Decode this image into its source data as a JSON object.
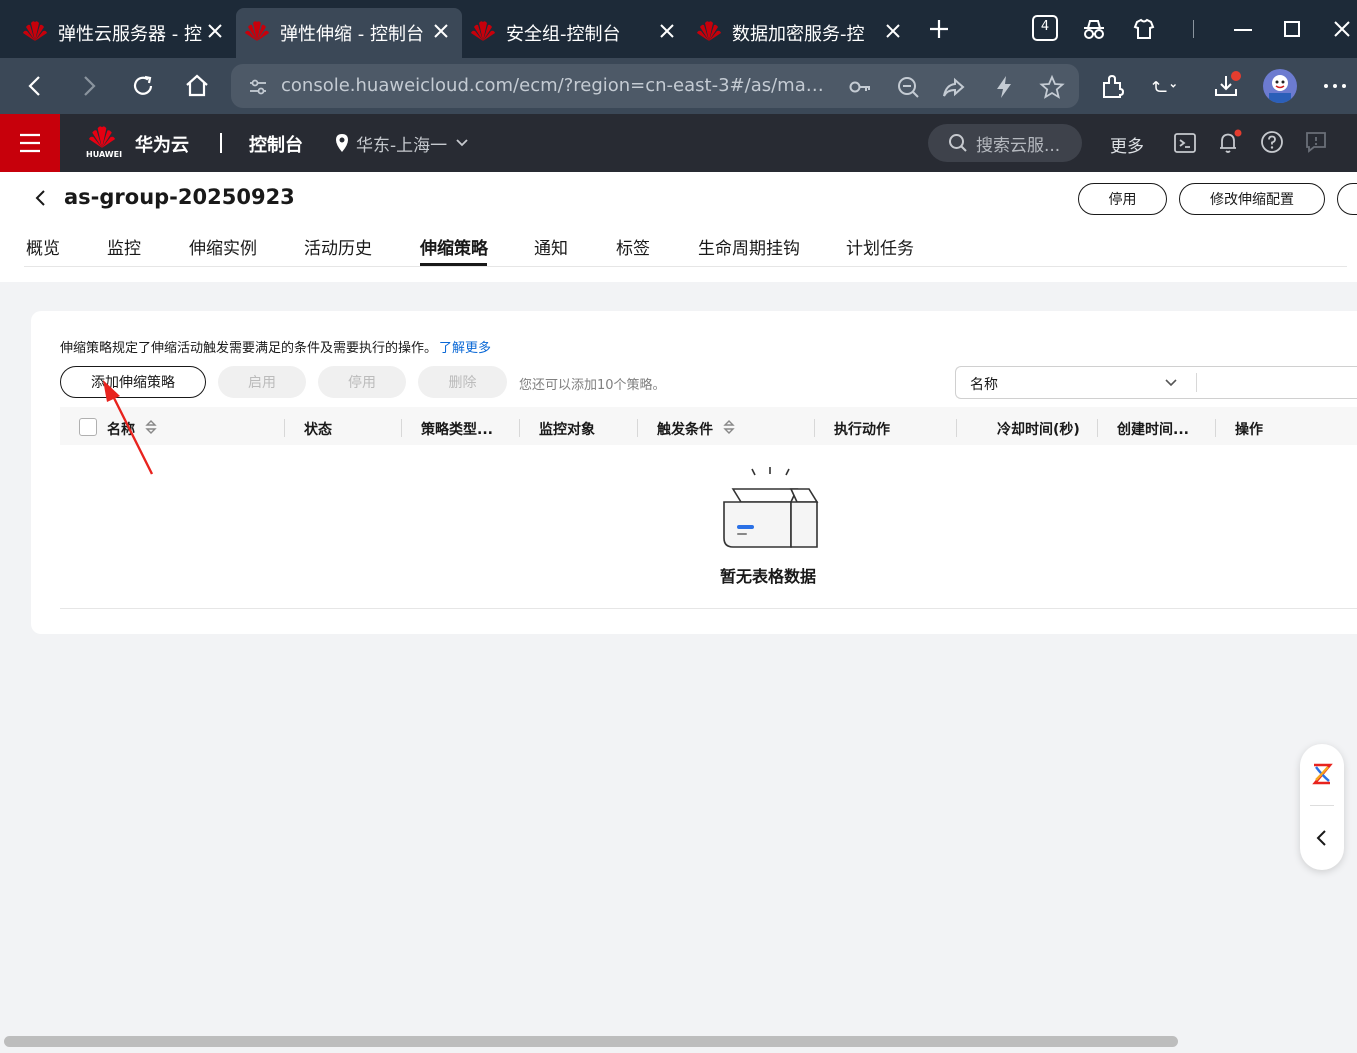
{
  "browser": {
    "tabs": [
      {
        "title": "弹性云服务器 - 控",
        "active": false
      },
      {
        "title": "弹性伸缩 - 控制台",
        "active": true
      },
      {
        "title": "安全组-控制台",
        "active": false
      },
      {
        "title": "数据加密服务-控",
        "active": false
      }
    ],
    "tab_count_badge": "4",
    "url": "console.huaweicloud.com/ecm/?region=cn-east-3#/as/mana..."
  },
  "console": {
    "brand": "华为云",
    "brand_sub": "HUAWEI",
    "section": "控制台",
    "region": "华东-上海一",
    "search_placeholder": "搜索云服...",
    "more": "更多"
  },
  "page": {
    "title": "as-group-20250923",
    "actions": {
      "disable": "停用",
      "modify": "修改伸缩配置"
    },
    "tabs": [
      "概览",
      "监控",
      "伸缩实例",
      "活动历史",
      "伸缩策略",
      "通知",
      "标签",
      "生命周期挂钩",
      "计划任务"
    ],
    "active_tab": "伸缩策略"
  },
  "policy_panel": {
    "description": "伸缩策略规定了伸缩活动触发需要满足的条件及需要执行的操作。",
    "learn_more": "了解更多",
    "buttons": {
      "add": "添加伸缩策略",
      "enable": "启用",
      "disable": "停用",
      "delete": "删除"
    },
    "quota_hint": "您还可以添加10个策略。",
    "filter_select": "名称",
    "columns": [
      "名称",
      "状态",
      "策略类型...",
      "监控对象",
      "触发条件",
      "执行动作",
      "冷却时间(秒)",
      "创建时间...",
      "操作"
    ],
    "empty_text": "暂无表格数据"
  },
  "colors": {
    "huawei_red": "#c7000b",
    "link_blue": "#0a68d6",
    "tab_strip": "#1d2a38",
    "toolbar": "#3b4857",
    "console_bar": "#282b33"
  }
}
